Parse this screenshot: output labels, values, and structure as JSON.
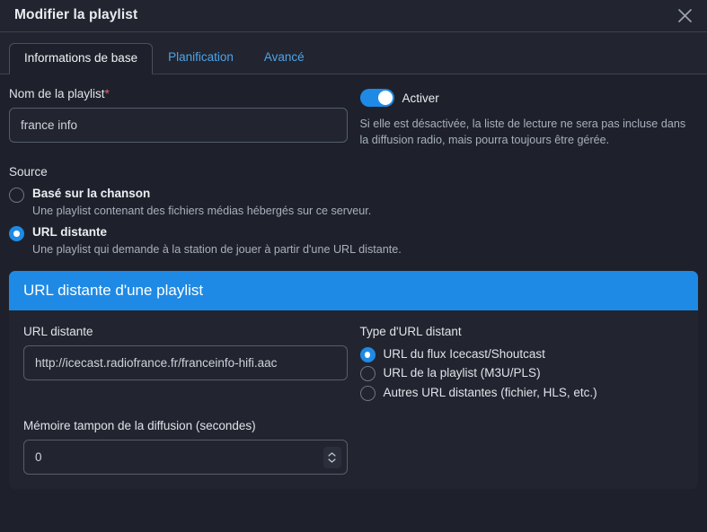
{
  "modal": {
    "title": "Modifier la playlist",
    "close_icon": "close-icon"
  },
  "tabs": [
    {
      "label": "Informations de base",
      "active": true
    },
    {
      "label": "Planification",
      "active": false
    },
    {
      "label": "Avancé",
      "active": false
    }
  ],
  "basic_info": {
    "name_label": "Nom de la playlist",
    "name_required_mark": "*",
    "name_value": "france info",
    "enable_toggle_label": "Activer",
    "enable_toggle_on": true,
    "enable_help": "Si elle est désactivée, la liste de lecture ne sera pas incluse dans la diffusion radio, mais pourra toujours être gérée.",
    "source_label": "Source",
    "source_options": [
      {
        "title": "Basé sur la chanson",
        "description": "Une playlist contenant des fichiers médias hébergés sur ce serveur.",
        "selected": false
      },
      {
        "title": "URL distante",
        "description": "Une playlist qui demande à la station de jouer à partir d'une URL distante.",
        "selected": true
      }
    ]
  },
  "remote_card": {
    "header": "URL distante d'une playlist",
    "url_label": "URL distante",
    "url_value": "http://icecast.radiofrance.fr/franceinfo-hifi.aac",
    "type_label": "Type d'URL distant",
    "type_options": [
      {
        "label": "URL du flux Icecast/Shoutcast",
        "selected": true
      },
      {
        "label": "URL de la playlist (M3U/PLS)",
        "selected": false
      },
      {
        "label": "Autres URL distantes (fichier, HLS, etc.)",
        "selected": false
      }
    ],
    "buffer_label": "Mémoire tampon de la diffusion (secondes)",
    "buffer_value": "0",
    "spinner_icon": "up-down-chevron-icon"
  },
  "colors": {
    "accent": "#1e8ae5",
    "page_background": "#1e212b",
    "surface": "#22252f",
    "required": "#e4606d",
    "link": "#4ea3e8"
  }
}
